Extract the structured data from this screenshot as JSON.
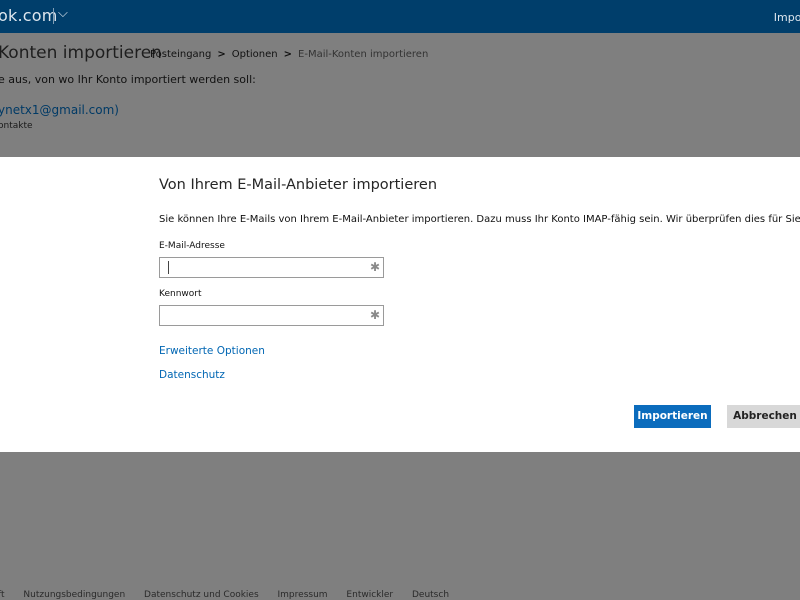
{
  "topbar": {
    "brand": "ok.com",
    "chevron_icon": "chevron-down-icon",
    "right_label": "Impor"
  },
  "page": {
    "title": "Konten importieren",
    "breadcrumb": [
      "Posteingang",
      "Optionen",
      "E-Mail-Konten importieren"
    ],
    "breadcrumb_separator": ">",
    "instruction": "e aus, von wo Ihr Konto importiert werden soll:",
    "account": "ynetx1@gmail.com)",
    "account_sub": "ontakte"
  },
  "modal": {
    "title": "Von Ihrem E-Mail-Anbieter importieren",
    "description": "Sie können Ihre E-Mails von Ihrem E-Mail-Anbieter importieren. Dazu muss Ihr Konto IMAP-fähig sein. Wir überprüfen dies für Sie.",
    "email_label": "E-Mail-Adresse",
    "email_value": "",
    "password_label": "Kennwort",
    "password_value": "",
    "required_marker": "✱",
    "advanced_link": "Erweiterte Optionen",
    "privacy_link": "Datenschutz",
    "import_button": "Importieren",
    "cancel_button": "Abbrechen"
  },
  "footer": {
    "items": [
      "ft",
      "Nutzungsbedingungen",
      "Datenschutz und Cookies",
      "Impressum",
      "Entwickler",
      "Deutsch"
    ]
  },
  "colors": {
    "topbar": "#003e6b",
    "primary": "#0b6cbd",
    "link": "#0066b3",
    "overlay": "#7f7f7f"
  }
}
